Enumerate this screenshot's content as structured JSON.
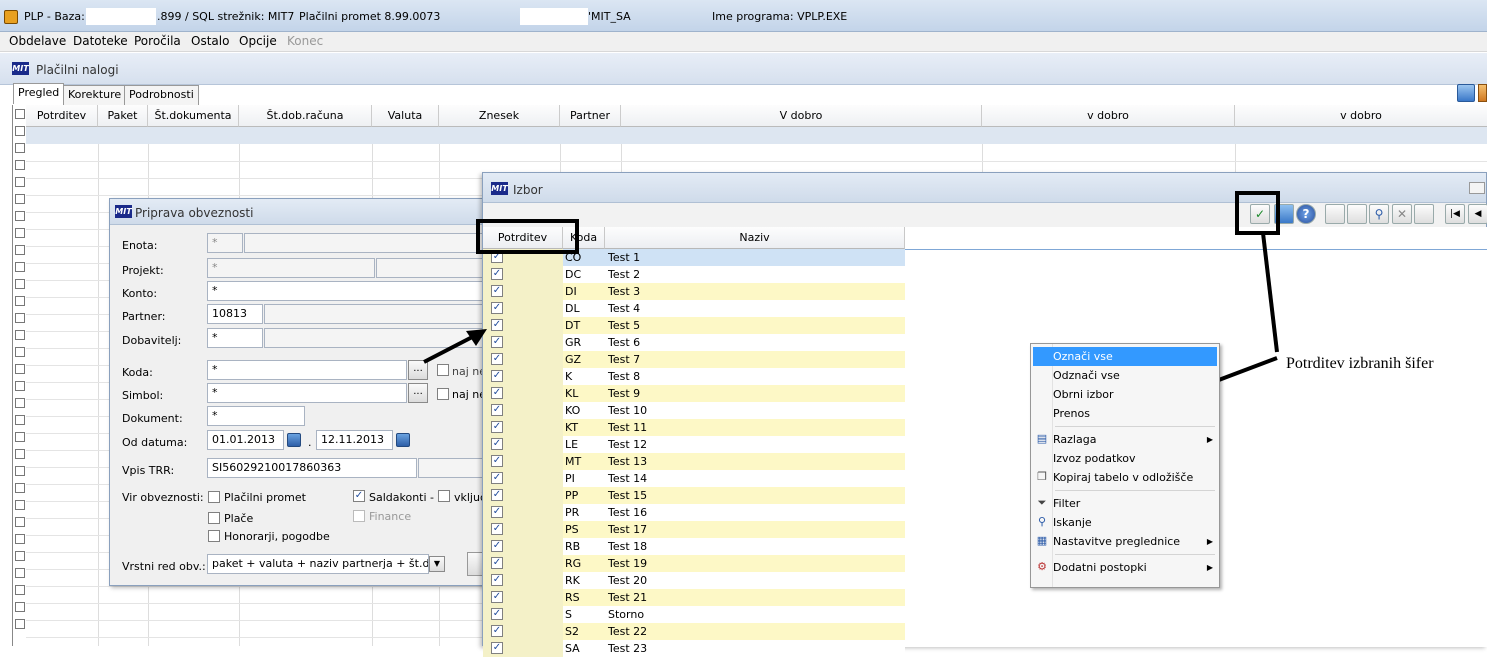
{
  "titlebar": {
    "prefix": "PLP - Baza:",
    "db_suffix": ".899 / SQL strežnik: MIT7",
    "app": "Plačilni promet 8.99.0073",
    "user_suffix": "'MIT_SA",
    "program": "Ime programa: VPLP.EXE"
  },
  "menubar": [
    "Obdelave",
    "Datoteke",
    "Poročila",
    "Ostalo",
    "Opcije",
    "Konec"
  ],
  "module": {
    "logo": "MIT",
    "title": "Plačilni nalogi"
  },
  "tabs": [
    "Pregled",
    "Korekture",
    "Podrobnosti"
  ],
  "main_grid": {
    "columns": [
      "Potrditev",
      "Paket",
      "Št.dokumenta",
      "Št.dob.računa",
      "Valuta",
      "Znesek",
      "Partner",
      "V dobro",
      "v dobro",
      "v dobro"
    ]
  },
  "priprava": {
    "title": "Priprava obveznosti",
    "labels": {
      "enota": "Enota:",
      "projekt": "Projekt:",
      "konto": "Konto:",
      "partner": "Partner:",
      "dobavitelj": "Dobavitelj:",
      "koda": "Koda:",
      "simbol": "Simbol:",
      "dokument": "Dokument:",
      "od_datuma": "Od datuma:",
      "vpis_trr": "Vpis TRR:",
      "vir": "Vir obveznosti:",
      "vrstni_red": "Vrstni red obv.:"
    },
    "values": {
      "enota": "*",
      "projekt": "*",
      "konto": "*",
      "partner": "10813",
      "dobavitelj": "*",
      "koda": "*",
      "simbol": "*",
      "dokument": "*",
      "od": "01.01.2013",
      "do": "12.11.2013",
      "trr": "SI56029210017860363",
      "vrstni_red": "paket + valuta + naziv partnerja + št.dokumer"
    },
    "ellipsis": "...",
    "date_sep": ".",
    "naj_ne": "naj ne",
    "checkboxes": {
      "placilni_promet": "Plačilni promet",
      "saldakonti": "Saldakonti -",
      "vkljuc": "vključ",
      "place": "Plače",
      "finance": "Finance",
      "honorarji": "Honorarji, pogodbe"
    },
    "dropdown_arrow": "▼"
  },
  "izbor": {
    "title": "Izbor",
    "columns": [
      "Potrditev",
      "Koda",
      "Naziv"
    ],
    "rows": [
      {
        "koda": "CO",
        "naziv": "Test 1"
      },
      {
        "koda": "DC",
        "naziv": "Test 2"
      },
      {
        "koda": "DI",
        "naziv": "Test 3"
      },
      {
        "koda": "DL",
        "naziv": "Test 4"
      },
      {
        "koda": "DT",
        "naziv": "Test 5"
      },
      {
        "koda": "GR",
        "naziv": "Test 6"
      },
      {
        "koda": "GZ",
        "naziv": "Test 7"
      },
      {
        "koda": "K",
        "naziv": "Test 8"
      },
      {
        "koda": "KL",
        "naziv": "Test 9"
      },
      {
        "koda": "KO",
        "naziv": "Test 10"
      },
      {
        "koda": "KT",
        "naziv": "Test 11"
      },
      {
        "koda": "LE",
        "naziv": "Test 12"
      },
      {
        "koda": "MT",
        "naziv": "Test 13"
      },
      {
        "koda": "PI",
        "naziv": "Test 14"
      },
      {
        "koda": "PP",
        "naziv": "Test 15"
      },
      {
        "koda": "PR",
        "naziv": "Test 16"
      },
      {
        "koda": "PS",
        "naziv": "Test 17"
      },
      {
        "koda": "RB",
        "naziv": "Test 18"
      },
      {
        "koda": "RG",
        "naziv": "Test 19"
      },
      {
        "koda": "RK",
        "naziv": "Test 20"
      },
      {
        "koda": "RS",
        "naziv": "Test 21"
      },
      {
        "koda": "S",
        "naziv": "Storno"
      },
      {
        "koda": "S2",
        "naziv": "Test 22"
      },
      {
        "koda": "SA",
        "naziv": "Test 23"
      }
    ],
    "check_mark": "✓"
  },
  "context_menu": {
    "items": [
      "Označi vse",
      "Odznači vse",
      "Obrni izbor",
      "Prenos",
      "Razlaga",
      "Izvoz podatkov",
      "Kopiraj tabelo v odložišče",
      "Filter",
      "Iskanje",
      "Nastavitve preglednice",
      "Dodatni postopki"
    ],
    "submenu_arrow": "▶"
  },
  "annotation": "Potrditev izbranih šifer",
  "colors": {
    "row_yellow": "#fdf8c6",
    "menu_highlight": "#3399ff",
    "check_green": "#1a8a2a"
  }
}
